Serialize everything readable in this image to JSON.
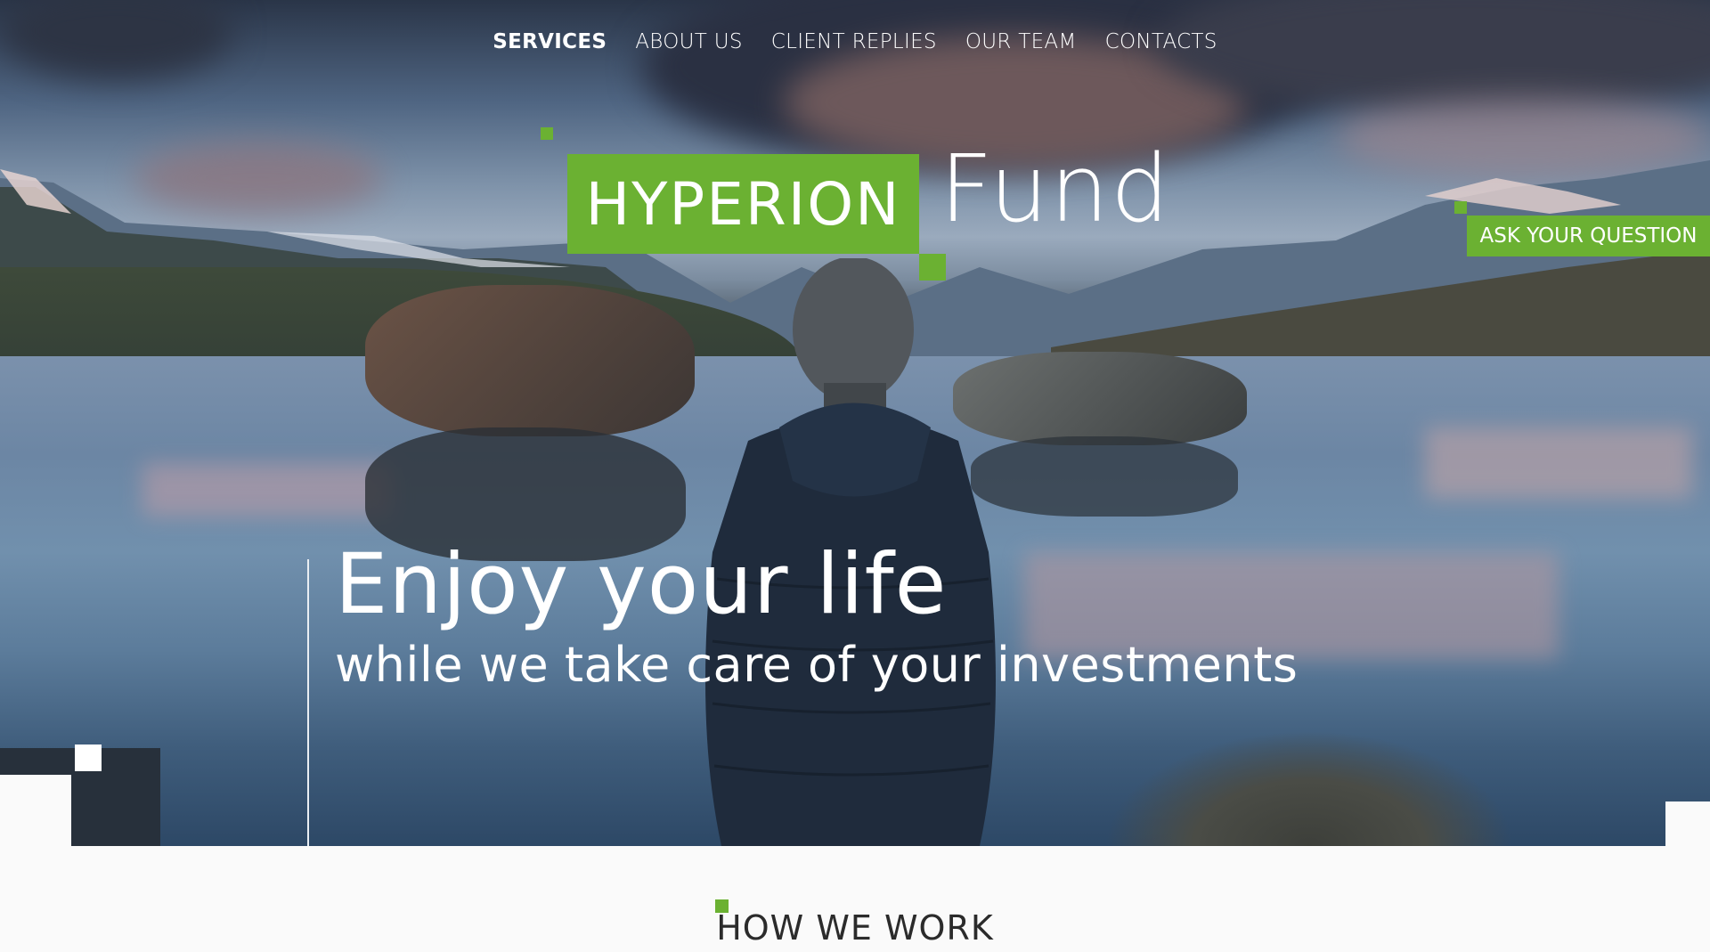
{
  "nav": {
    "items": [
      {
        "label": "SERVICES",
        "active": true
      },
      {
        "label": "ABOUT US",
        "active": false
      },
      {
        "label": "CLIENT REPLIES",
        "active": false
      },
      {
        "label": "OUR TEAM",
        "active": false
      },
      {
        "label": "CONTACTS",
        "active": false
      }
    ]
  },
  "logo": {
    "boxed": "HYPERION",
    "plain": "Fund"
  },
  "cta": {
    "ask_label": "ASK YOUR QUESTION"
  },
  "hero": {
    "headline": "Enjoy your life",
    "subline": "while we take care of your investments"
  },
  "section": {
    "title": "HOW WE WORK"
  },
  "colors": {
    "accent": "#6bb132",
    "text_dark": "#2b2b2b",
    "page_bg": "#fafafa"
  }
}
